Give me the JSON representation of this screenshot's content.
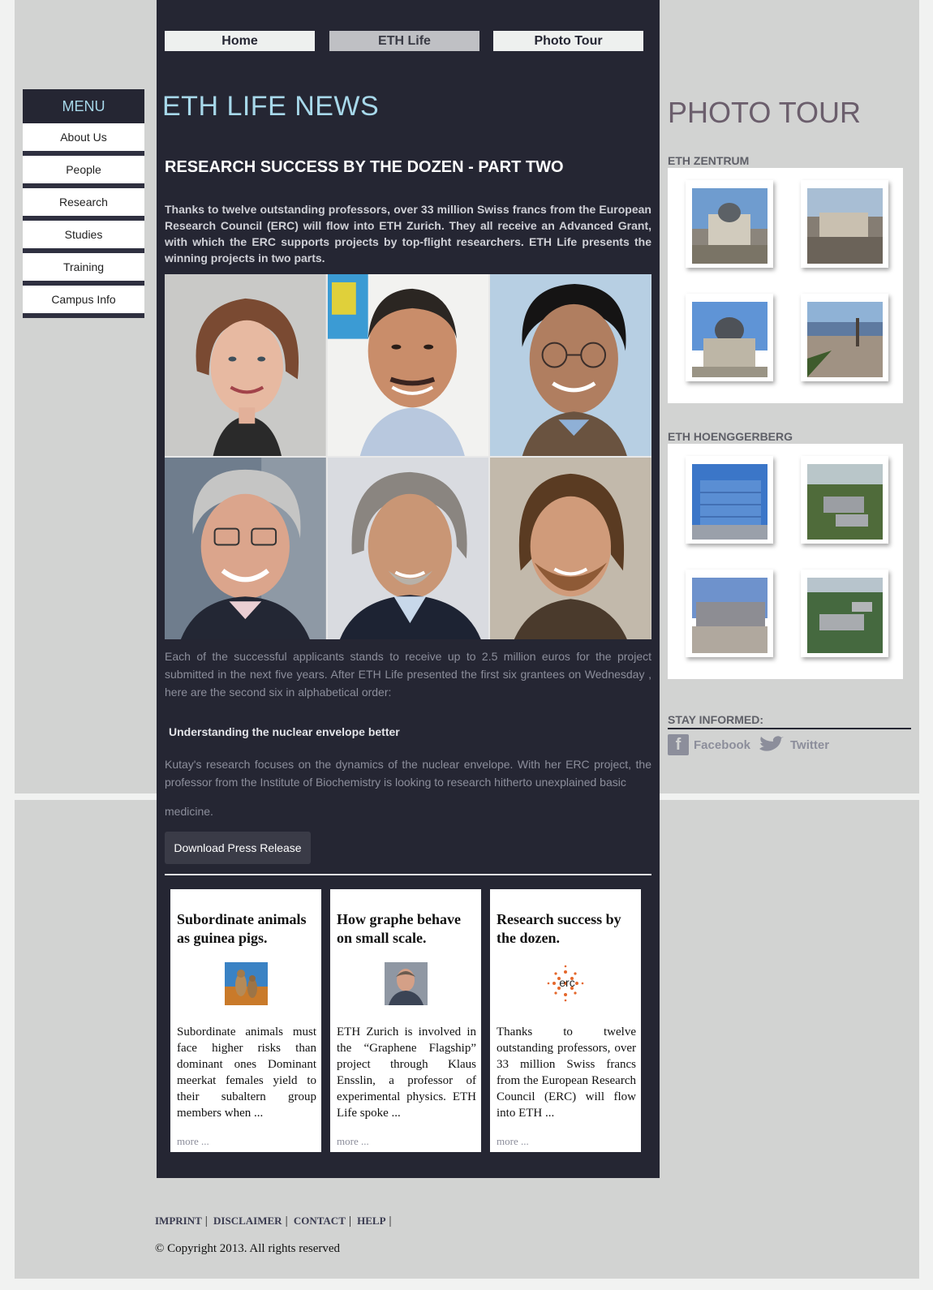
{
  "nav": {
    "home": "Home",
    "eth_life": "ETH Life",
    "photo_tour": "Photo Tour"
  },
  "sidebar": {
    "menu_title": "MENU",
    "items": [
      {
        "label": "About Us"
      },
      {
        "label": "People"
      },
      {
        "label": "Research"
      },
      {
        "label": "Studies"
      },
      {
        "label": "Training"
      },
      {
        "label": "Campus Info"
      }
    ]
  },
  "main": {
    "section_title": "ETH LIFE NEWS",
    "article_title": "RESEARCH SUCCESS BY THE DOZEN - PART TWO",
    "intro": "Thanks to twelve outstanding professors, over 33 million Swiss francs from the European Research Council (ERC) will flow into ETH Zurich. They all receive an Advanced Grant, with which the ERC supports projects by top-flight researchers. ETH Life presents the winning projects in two parts.",
    "paragraph1": "Each of the successful applicants stands to receive up to 2.5 million euros for the project submitted in the next five years. After ETH Life presented the first six grantees on Wednesday , here are the second six in alphabetical order:",
    "subheading": "Understanding the nuclear envelope better",
    "paragraph2": "Kutay's research focuses on the dynamics of the nuclear envelope. With her ERC project, the professor from the Institute of Biochemistry is looking to research hitherto unexplained basic",
    "paragraph2_tail": "medicine.",
    "download_button": "Download Press Release",
    "cards": [
      {
        "title": "Subordinate animals as guinea pigs.",
        "text": "Subordinate animals must face higher risks than dominant ones Dominant meerkat females yield to their subaltern group members when ...",
        "more": "more ..."
      },
      {
        "title": "How graphe behave on small scale.",
        "text": "ETH Zurich is involved in the “Graphene Flagship” project through Klaus Ensslin, a professor of experimental physics. ETH Life spoke ...",
        "more": "more ..."
      },
      {
        "title": "Research success by the dozen.",
        "text": "Thanks to twelve outstanding professors, over 33 million Swiss francs from the European Research Council (ERC) will flow into ETH ...",
        "more": "more ...",
        "logo_text": "erc"
      }
    ]
  },
  "right": {
    "photo_tour_title": "PHOTO TOUR",
    "zentrum_label": "ETH ZENTRUM",
    "hoengg_label": "ETH HOENGGERBERG",
    "stay_informed": "STAY INFORMED:",
    "facebook": "Facebook",
    "twitter": "Twitter"
  },
  "footer": {
    "imprint": "IMPRINT",
    "disclaimer": "DISCLAIMER",
    "contact": "CONTACT",
    "help": "HELP",
    "copyright": "© Copyright 2013. All rights reserved"
  },
  "colors": {
    "main_bg": "#252633",
    "page_bg": "#d2d3d2",
    "accent": "#a7d8ea",
    "photo_tour_title": "#6b5e6c",
    "muted_text": "#8c8e9b"
  },
  "icons": {
    "facebook": "facebook-icon",
    "twitter": "twitter-bird-icon"
  }
}
